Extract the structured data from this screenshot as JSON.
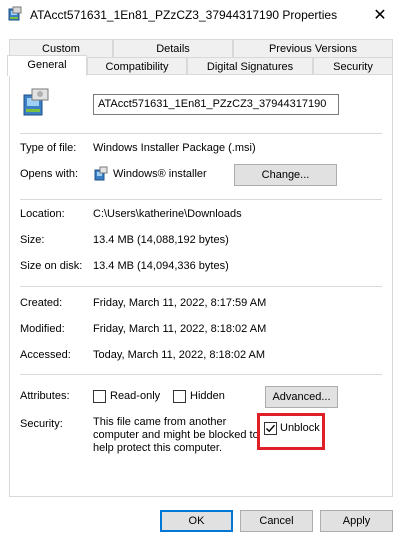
{
  "window": {
    "title": "ATAcct571631_1En81_PZzCZ3_37944317190 Properties",
    "close_glyph": "✕"
  },
  "tabs_row1": [
    {
      "label": "Custom"
    },
    {
      "label": "Details"
    },
    {
      "label": "Previous Versions"
    }
  ],
  "tabs_row2": [
    {
      "label": "General",
      "active": true
    },
    {
      "label": "Compatibility"
    },
    {
      "label": "Digital Signatures"
    },
    {
      "label": "Security"
    }
  ],
  "general": {
    "file_name": "ATAcct571631_1En81_PZzCZ3_37944317190",
    "type_label": "Type of file:",
    "type_value": "Windows Installer Package (.msi)",
    "opens_label": "Opens with:",
    "opens_value": "Windows® installer",
    "change_button": "Change...",
    "location_label": "Location:",
    "location_value": "C:\\Users\\katherine\\Downloads",
    "size_label": "Size:",
    "size_value": "13.4 MB (14,088,192 bytes)",
    "size_disk_label": "Size on disk:",
    "size_disk_value": "13.4 MB (14,094,336 bytes)",
    "created_label": "Created:",
    "created_value": "Friday, March 11, 2022, 8:17:59 AM",
    "modified_label": "Modified:",
    "modified_value": "Friday, March 11, 2022, 8:18:02 AM",
    "accessed_label": "Accessed:",
    "accessed_value": "Today, March 11, 2022, 8:18:02 AM",
    "attributes_label": "Attributes:",
    "readonly_label": "Read-only",
    "readonly_checked": false,
    "hidden_label": "Hidden",
    "hidden_checked": false,
    "advanced_button": "Advanced...",
    "security_label": "Security:",
    "security_text": "This file came from another computer and might be blocked to help protect this computer.",
    "unblock_label": "Unblock",
    "unblock_checked": true,
    "highlight_color": "#e02028"
  },
  "footer": {
    "ok": "OK",
    "cancel": "Cancel",
    "apply": "Apply"
  },
  "icons": {
    "title": "msi-package-icon",
    "file": "msi-package-icon",
    "opens_with": "windows-installer-icon"
  }
}
